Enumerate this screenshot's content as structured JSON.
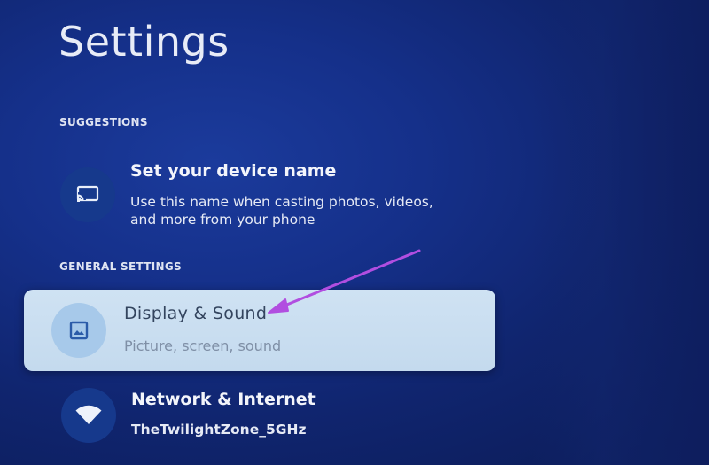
{
  "title": "Settings",
  "sections": {
    "suggestions": {
      "header": "SUGGESTIONS",
      "item": {
        "title": "Set your device name",
        "subtitle_line1": "Use this name when casting photos, videos,",
        "subtitle_line2": "and more from your phone",
        "icon": "cast-icon"
      }
    },
    "general": {
      "header": "GENERAL SETTINGS",
      "items": [
        {
          "title": "Display & Sound",
          "subtitle": "Picture, screen, sound",
          "icon": "image-icon",
          "focused": true
        },
        {
          "title": "Network & Internet",
          "subtitle": "TheTwilightZone_5GHz",
          "icon": "wifi-icon"
        }
      ]
    }
  },
  "colors": {
    "background": "#15308a",
    "focus_card": "#cfe2f3",
    "icon_circle": "#16398c",
    "annotation_arrow": "#b14ee0"
  }
}
